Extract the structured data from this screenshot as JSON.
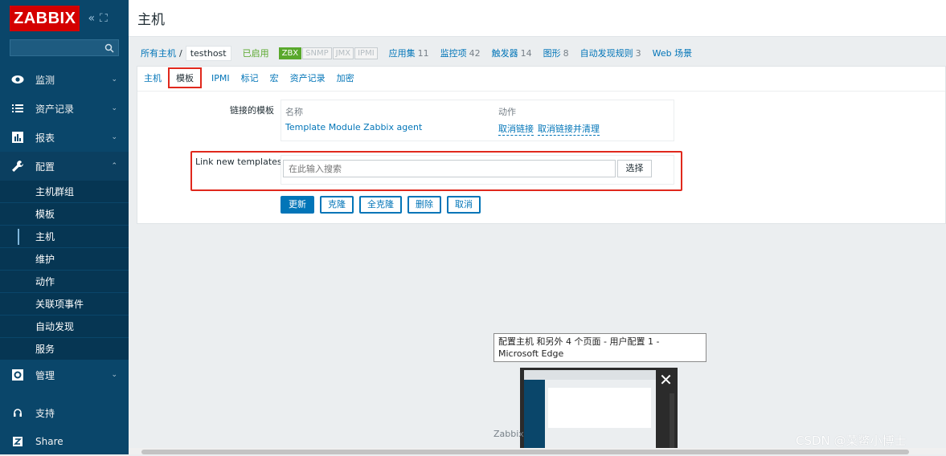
{
  "sidebar": {
    "logo": "ZABBIX",
    "menu": [
      {
        "label": "监测",
        "icon": "eye-icon"
      },
      {
        "label": "资产记录",
        "icon": "list-icon"
      },
      {
        "label": "报表",
        "icon": "bar-chart-icon"
      },
      {
        "label": "配置",
        "icon": "wrench-icon"
      }
    ],
    "submenu": [
      "主机群组",
      "模板",
      "主机",
      "维护",
      "动作",
      "关联项事件",
      "自动发现",
      "服务"
    ],
    "admin": {
      "label": "管理",
      "icon": "gear-icon"
    },
    "support": {
      "label": "支持",
      "icon": "headset-icon"
    },
    "share": {
      "label": "Share",
      "icon": "share-z-icon"
    }
  },
  "header": {
    "title": "主机"
  },
  "breadcrumb": {
    "all_hosts": "所有主机",
    "separator": "/",
    "current": "testhost",
    "enabled": "已启用",
    "tags": [
      "ZBX",
      "SNMP",
      "JMX",
      "IPMI"
    ],
    "links": [
      {
        "label": "应用集",
        "count": "11"
      },
      {
        "label": "监控项",
        "count": "42"
      },
      {
        "label": "触发器",
        "count": "14"
      },
      {
        "label": "图形",
        "count": "8"
      },
      {
        "label": "自动发现规则",
        "count": "3"
      },
      {
        "label": "Web 场景",
        "count": ""
      }
    ]
  },
  "tabs": [
    "主机",
    "模板",
    "IPMI",
    "标记",
    "宏",
    "资产记录",
    "加密"
  ],
  "form": {
    "linked_label": "链接的模板",
    "col_name": "名称",
    "col_action": "动作",
    "template_name": "Template Module Zabbix agent",
    "unlink": "取消链接",
    "unlink_clear": "取消链接并清理",
    "link_new_label": "Link new templates",
    "search_placeholder": "在此输入搜索",
    "select_btn": "选择"
  },
  "buttons": [
    "更新",
    "克隆",
    "全克隆",
    "删除",
    "取消"
  ],
  "taskbar_tooltip": "配置主机 和另外 4 个页面 - 用户配置 1 - Microsoft Edge",
  "footer": "Zabbix",
  "watermark": "CSDN @菜鳖小博士",
  "colors": {
    "sidebar": "#0a466a",
    "link": "#0275b8",
    "highlight": "#e0281c",
    "enabled": "#59a82c"
  }
}
